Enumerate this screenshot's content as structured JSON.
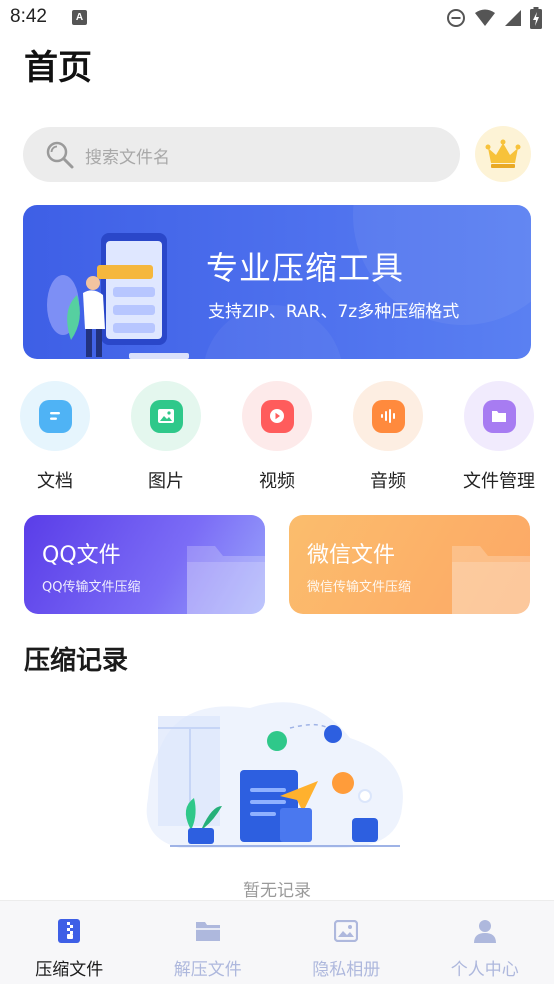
{
  "status_bar": {
    "time": "8:42",
    "notification_icon": "A"
  },
  "page": {
    "title": "首页"
  },
  "search": {
    "placeholder": "搜索文件名"
  },
  "banner": {
    "title": "专业压缩工具",
    "subtitle": "支持ZIP、RAR、7z多种压缩格式"
  },
  "categories": [
    {
      "label": "文档",
      "icon": "document-icon",
      "color": "#4fb3f5",
      "bg": "#e6f5fd"
    },
    {
      "label": "图片",
      "icon": "image-icon",
      "color": "#2fc88a",
      "bg": "#e4f7ee"
    },
    {
      "label": "视频",
      "icon": "video-icon",
      "color": "#ff5c5c",
      "bg": "#fdeaea"
    },
    {
      "label": "音频",
      "icon": "audio-icon",
      "color": "#ff8a3d",
      "bg": "#fdeee2"
    },
    {
      "label": "文件管理",
      "icon": "folder-icon",
      "color": "#a77cf2",
      "bg": "#f1ebfd"
    }
  ],
  "folders": [
    {
      "title": "QQ文件",
      "subtitle": "QQ传输文件压缩"
    },
    {
      "title": "微信文件",
      "subtitle": "微信传输文件压缩"
    }
  ],
  "history": {
    "title": "压缩记录",
    "empty_text": "暂无记录"
  },
  "nav": [
    {
      "label": "压缩文件",
      "icon": "zip-file-icon",
      "active": true
    },
    {
      "label": "解压文件",
      "icon": "unzip-folder-icon",
      "active": false
    },
    {
      "label": "隐私相册",
      "icon": "photo-album-icon",
      "active": false
    },
    {
      "label": "个人中心",
      "icon": "user-icon",
      "active": false
    }
  ],
  "colors": {
    "accent": "#3e5fe6",
    "nav_inactive": "#aeb8dd",
    "qq_card": "#6a4cf0",
    "wechat_card": "#fbb060"
  }
}
